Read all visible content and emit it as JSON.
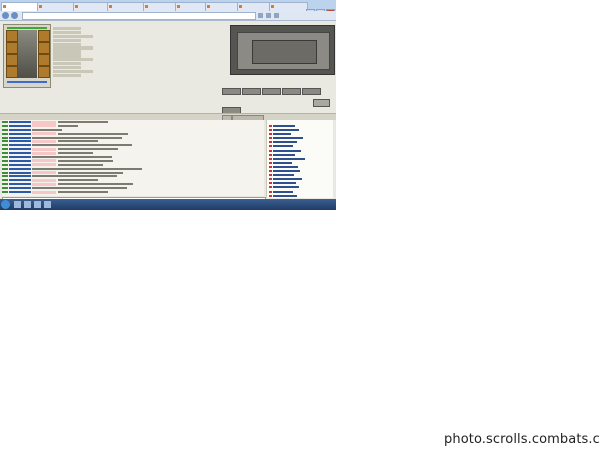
{
  "browser": {
    "tabs": [
      "",
      "",
      "",
      "",
      "",
      "",
      "",
      "",
      "",
      "",
      "",
      ""
    ],
    "url": "",
    "colors": {
      "accent": "#bcd3ee",
      "close": "#c9473a"
    }
  },
  "game": {
    "username": "",
    "caption": "",
    "notice": "",
    "online_header": ""
  },
  "taskbar": {
    "clock": ""
  },
  "watermark": "photo.scrolls.combats.com"
}
